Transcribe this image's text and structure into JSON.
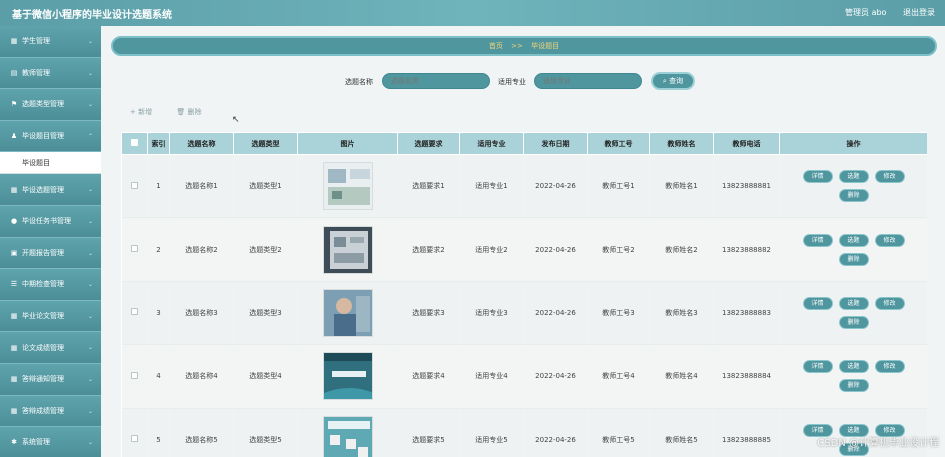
{
  "header": {
    "title": "基于微信小程序的毕业设计选题系统",
    "user": "管理员 abo",
    "logout": "退出登录"
  },
  "sidebar": {
    "items": [
      {
        "label": "学生管理",
        "icon": "grid-icon"
      },
      {
        "label": "教师管理",
        "icon": "book-icon"
      },
      {
        "label": "选题类型管理",
        "icon": "flag-icon"
      },
      {
        "label": "毕设题目管理",
        "icon": "person-icon",
        "expanded": true
      },
      {
        "label": "毕设选题管理",
        "icon": "grid-icon"
      },
      {
        "label": "毕设任务书管理",
        "icon": "pin-icon"
      },
      {
        "label": "开题报告管理",
        "icon": "doc-icon"
      },
      {
        "label": "中期检查管理",
        "icon": "list-icon"
      },
      {
        "label": "毕业论文管理",
        "icon": "grid-icon"
      },
      {
        "label": "论文成绩管理",
        "icon": "grid-icon"
      },
      {
        "label": "答辩通知管理",
        "icon": "grid-icon"
      },
      {
        "label": "答辩成绩管理",
        "icon": "grid-icon"
      },
      {
        "label": "系统管理",
        "icon": "settings-icon"
      }
    ],
    "submenu": {
      "label": "毕设题目"
    }
  },
  "breadcrumb": {
    "home": "首页",
    "sep": ">>",
    "current": "毕设题目"
  },
  "search": {
    "name_label": "选题名称",
    "name_placeholder": "选题名称",
    "major_label": "适用专业",
    "major_placeholder": "适用专业",
    "button": "查询"
  },
  "actions": {
    "add": "+ 新增",
    "delete": "删除"
  },
  "table": {
    "columns": [
      "",
      "索引",
      "选题名称",
      "选题类型",
      "图片",
      "选题要求",
      "适用专业",
      "发布日期",
      "教师工号",
      "教师姓名",
      "教师电话",
      "操作"
    ],
    "ops": {
      "detail": "详情",
      "select": "选题",
      "edit": "修改",
      "delete": "删除"
    },
    "rows": [
      {
        "index": "1",
        "name": "选题名称1",
        "type": "选题类型1",
        "req": "选题要求1",
        "major": "适用专业1",
        "date": "2022-04-26",
        "tid": "教师工号1",
        "tname": "教师姓名1",
        "phone": "13823888881"
      },
      {
        "index": "2",
        "name": "选题名称2",
        "type": "选题类型2",
        "req": "选题要求2",
        "major": "适用专业2",
        "date": "2022-04-26",
        "tid": "教师工号2",
        "tname": "教师姓名2",
        "phone": "13823888882"
      },
      {
        "index": "3",
        "name": "选题名称3",
        "type": "选题类型3",
        "req": "选题要求3",
        "major": "适用专业3",
        "date": "2022-04-26",
        "tid": "教师工号3",
        "tname": "教师姓名3",
        "phone": "13823888883"
      },
      {
        "index": "4",
        "name": "选题名称4",
        "type": "选题类型4",
        "req": "选题要求4",
        "major": "适用专业4",
        "date": "2022-04-26",
        "tid": "教师工号4",
        "tname": "教师姓名4",
        "phone": "13823888884"
      },
      {
        "index": "5",
        "name": "选题名称5",
        "type": "选题类型5",
        "req": "选题要求5",
        "major": "适用专业5",
        "date": "2022-04-26",
        "tid": "教师工号5",
        "tname": "教师姓名5",
        "phone": "13823888885"
      }
    ]
  },
  "watermark": "CSDN @计算机毕业设计程",
  "colors": {
    "header": "#5b9ea8",
    "accent": "#4f969f",
    "table_head": "#a9d3d8",
    "breadcrumb_text": "#f5d47a"
  }
}
